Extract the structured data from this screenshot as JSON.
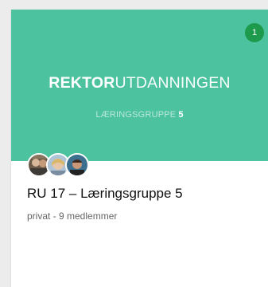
{
  "card": {
    "notification_count": "1",
    "cover": {
      "logo_bold": "REKTOR",
      "logo_light": "UTDANNINGEN",
      "subtitle_text": "LÆRINGSGRUPPE",
      "subtitle_number": "5",
      "background_color": "#4cc39e"
    },
    "avatars": [
      "member-avatar",
      "member-avatar",
      "member-avatar"
    ],
    "title": "RU 17 – Læringsgruppe 5",
    "meta": "privat - 9 medlemmer"
  }
}
